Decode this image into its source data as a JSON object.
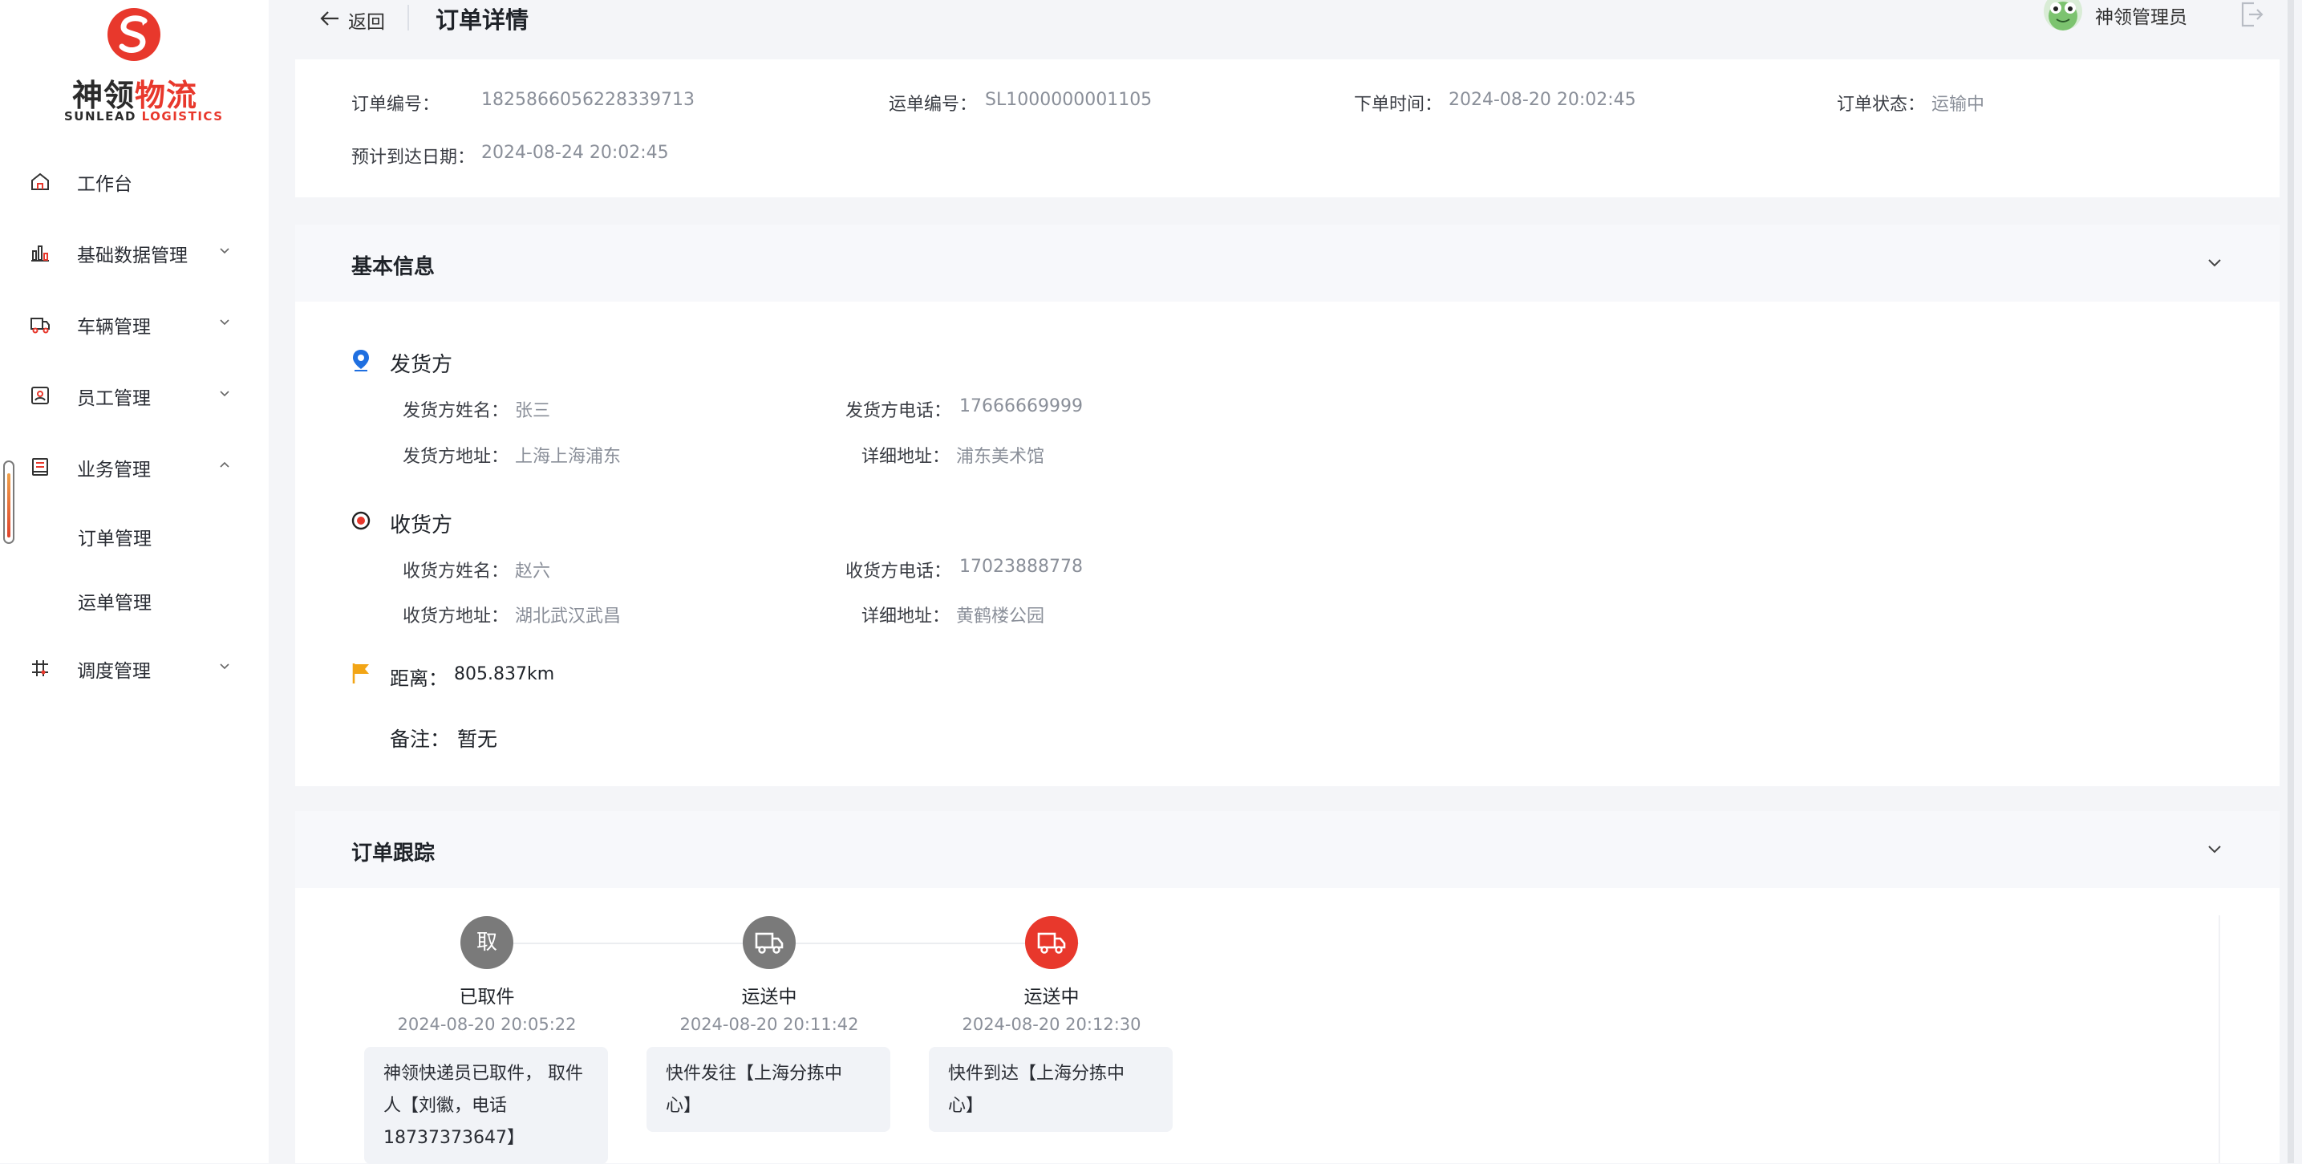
{
  "brand": {
    "name_part1": "神领",
    "name_part2": "物流",
    "sub_part1": "SUNLEAD ",
    "sub_part2": "LOGISTICS",
    "colors": {
      "red": "#e8382c",
      "dark": "#2b2b2b"
    }
  },
  "sidebar": {
    "items": [
      {
        "label": "工作台",
        "icon": "home-icon"
      },
      {
        "label": "基础数据管理",
        "icon": "bar-chart-icon"
      },
      {
        "label": "车辆管理",
        "icon": "truck-icon"
      },
      {
        "label": "员工管理",
        "icon": "id-card-icon"
      },
      {
        "label": "业务管理",
        "icon": "book-icon"
      },
      {
        "label": "调度管理",
        "icon": "dispatch-icon"
      }
    ],
    "sub_items": [
      {
        "label": "订单管理"
      },
      {
        "label": "运单管理"
      }
    ]
  },
  "header": {
    "back_label": "返回",
    "page_title": "订单详情",
    "user_name": "神领管理员"
  },
  "summary": {
    "order_no_label": "订单编号：",
    "order_no": "1825866056228339713",
    "waybill_no_label": "运单编号：",
    "waybill_no": "SL1000000001105",
    "order_time_label": "下单时间：",
    "order_time": "2024-08-20 20:02:45",
    "order_status_label": "订单状态：",
    "order_status": "运输中",
    "eta_label": "预计到达日期：",
    "eta": "2024-08-24 20:02:45"
  },
  "basic_info": {
    "title": "基本信息",
    "sender": {
      "title": "发货方",
      "name_label": "发货方姓名：",
      "name": "张三",
      "phone_label": "发货方电话：",
      "phone": "17666669999",
      "address_label": "发货方地址：",
      "address": "上海上海浦东",
      "detail_label": "详细地址：",
      "detail": "浦东美术馆"
    },
    "receiver": {
      "title": "收货方",
      "name_label": "收货方姓名：",
      "name": "赵六",
      "phone_label": "收货方电话：",
      "phone": "17023888778",
      "address_label": "收货方地址：",
      "address": "湖北武汉武昌",
      "detail_label": "详细地址：",
      "detail": "黄鹤楼公园"
    },
    "distance_label": "距离：",
    "distance": "805.837km",
    "remark_label": "备注：",
    "remark": "暂无"
  },
  "tracking": {
    "title": "订单跟踪",
    "steps": [
      {
        "glyph": "取",
        "status": "已取件",
        "time": "2024-08-20 20:05:22",
        "lines": [
          "神领快递员已取件， 取件",
          "人【刘徽，电话",
          "18737373647】"
        ],
        "color": "#7a7a7a"
      },
      {
        "glyph": "",
        "status": "运送中",
        "time": "2024-08-20 20:11:42",
        "lines": [
          "快件发往【上海分拣中",
          "心】"
        ],
        "color": "#7a7a7a"
      },
      {
        "glyph": "",
        "status": "运送中",
        "time": "2024-08-20 20:12:30",
        "lines": [
          "快件到达【上海分拣中",
          "心】"
        ],
        "color": "#e8382c"
      }
    ]
  }
}
